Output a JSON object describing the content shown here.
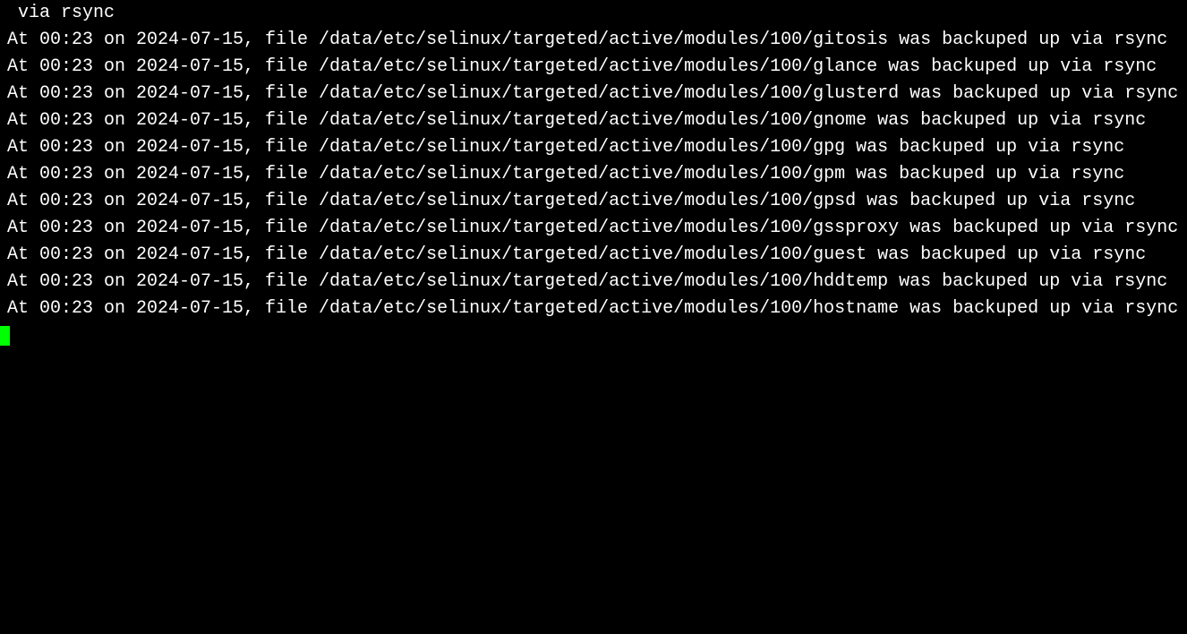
{
  "terminal": {
    "partial_first_line": " via rsync",
    "timestamp": "00:23",
    "date": "2024-07-15",
    "base_path": "/data/etc/selinux/targeted/active/modules/100/",
    "action_suffix": " was backuped up via rsync",
    "entries": [
      "At 00:23 on 2024-07-15, file /data/etc/selinux/targeted/active/modules/100/gitosis was backuped up via rsync",
      "At 00:23 on 2024-07-15, file /data/etc/selinux/targeted/active/modules/100/glance was backuped up via rsync",
      "At 00:23 on 2024-07-15, file /data/etc/selinux/targeted/active/modules/100/glusterd was backuped up via rsync",
      "At 00:23 on 2024-07-15, file /data/etc/selinux/targeted/active/modules/100/gnome was backuped up via rsync",
      "At 00:23 on 2024-07-15, file /data/etc/selinux/targeted/active/modules/100/gpg was backuped up via rsync",
      "At 00:23 on 2024-07-15, file /data/etc/selinux/targeted/active/modules/100/gpm was backuped up via rsync",
      "At 00:23 on 2024-07-15, file /data/etc/selinux/targeted/active/modules/100/gpsd was backuped up via rsync",
      "At 00:23 on 2024-07-15, file /data/etc/selinux/targeted/active/modules/100/gssproxy was backuped up via rsync",
      "At 00:23 on 2024-07-15, file /data/etc/selinux/targeted/active/modules/100/guest was backuped up via rsync",
      "At 00:23 on 2024-07-15, file /data/etc/selinux/targeted/active/modules/100/hddtemp was backuped up via rsync",
      "At 00:23 on 2024-07-15, file /data/etc/selinux/targeted/active/modules/100/hostname was backuped up via rsync"
    ]
  }
}
